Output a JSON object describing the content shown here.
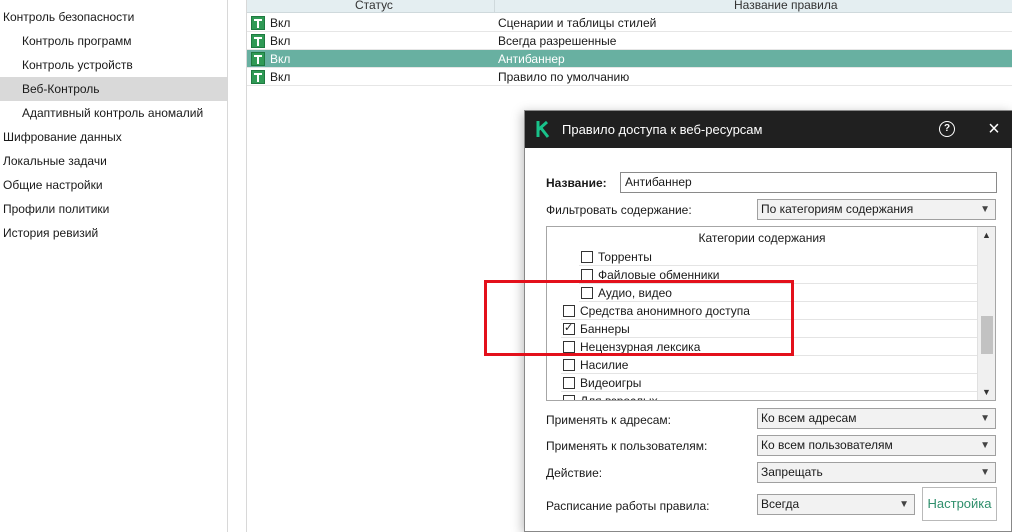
{
  "tree": [
    {
      "label": "Контроль безопасности",
      "child": false,
      "selected": false
    },
    {
      "label": "Контроль программ",
      "child": true,
      "selected": false
    },
    {
      "label": "Контроль устройств",
      "child": true,
      "selected": false
    },
    {
      "label": "Веб-Контроль",
      "child": true,
      "selected": true
    },
    {
      "label": "Адаптивный контроль аномалий",
      "child": true,
      "selected": false
    },
    {
      "label": "Шифрование данных",
      "child": false,
      "selected": false
    },
    {
      "label": "Локальные задачи",
      "child": false,
      "selected": false
    },
    {
      "label": "Общие настройки",
      "child": false,
      "selected": false
    },
    {
      "label": "Профили политики",
      "child": false,
      "selected": false
    },
    {
      "label": "История ревизий",
      "child": false,
      "selected": false
    }
  ],
  "rules": {
    "header_status": "Статус",
    "header_name": "Название правила",
    "rows": [
      {
        "status": "Вкл",
        "name": "Сценарии и таблицы стилей",
        "selected": false
      },
      {
        "status": "Вкл",
        "name": "Всегда разрешенные",
        "selected": false
      },
      {
        "status": "Вкл",
        "name": "Антибаннер",
        "selected": true
      },
      {
        "status": "Вкл",
        "name": "Правило по умолчанию",
        "selected": false
      }
    ]
  },
  "dialog": {
    "title": "Правило доступа к веб-ресурсам",
    "help_symbol": "?",
    "close_symbol": "×",
    "name_label": "Название:",
    "name_value": "Антибаннер",
    "filter_label": "Фильтровать содержание:",
    "filter_value": "По категориям содержания",
    "categories_header": "Категории содержания",
    "categories": [
      {
        "label": "Торренты",
        "checked": false,
        "indent": 2
      },
      {
        "label": "Файловые обменники",
        "checked": false,
        "indent": 2
      },
      {
        "label": "Аудио, видео",
        "checked": false,
        "indent": 2
      },
      {
        "label": "Средства анонимного доступа",
        "checked": false,
        "indent": 1
      },
      {
        "label": "Баннеры",
        "checked": true,
        "indent": 1
      },
      {
        "label": "Нецензурная лексика",
        "checked": false,
        "indent": 1
      },
      {
        "label": "Насилие",
        "checked": false,
        "indent": 1
      },
      {
        "label": "Видеоигры",
        "checked": false,
        "indent": 1
      },
      {
        "label": "Для взрослых",
        "checked": false,
        "indent": 1
      }
    ],
    "apply_addresses_label": "Применять к адресам:",
    "apply_addresses_value": "Ко всем адресам",
    "apply_users_label": "Применять к пользователям:",
    "apply_users_value": "Ко всем пользователям",
    "action_label": "Действие:",
    "action_value": "Запрещать",
    "schedule_label": "Расписание работы правила:",
    "schedule_value": "Всегда",
    "settings_button": "Настройка"
  },
  "colors": {
    "selected_row": "#68b0a1",
    "toggle_on": "#2f9a55",
    "dialog_title_bar": "#202020",
    "highlight_frame": "#e3101b",
    "button_text": "#2f8f6c"
  }
}
